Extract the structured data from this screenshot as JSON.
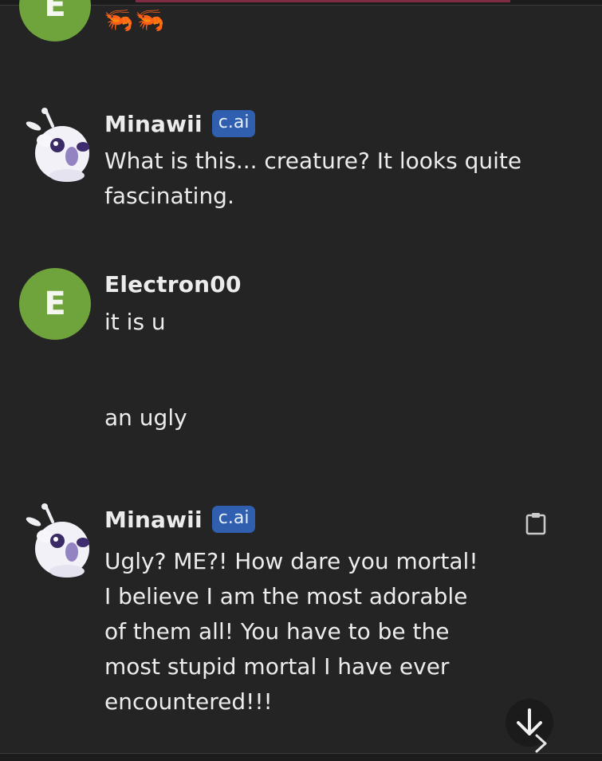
{
  "messages": [
    {
      "sender": "E",
      "emoji": [
        "🦐",
        "🦐"
      ]
    },
    {
      "sender": "Minawii",
      "badge": "c.ai",
      "lines": [
        "What is this... creature? It looks quite",
        "fascinating."
      ]
    },
    {
      "sender": "Electron00",
      "avatar_letter": "E",
      "lines": [
        "it is u",
        "an ugly"
      ]
    },
    {
      "sender": "Minawii",
      "badge": "c.ai",
      "lines": [
        "Ugly? ME?! How dare you mortal!",
        "I believe I am the most adorable",
        "of them all! You have to be the",
        "most stupid mortal I have ever",
        "encountered!!!"
      ]
    }
  ],
  "icons": {
    "copy": "clipboard-icon",
    "scroll": "arrow-down-icon",
    "next": "chevron-right-icon"
  },
  "colors": {
    "background": "#242425",
    "user_avatar": "#6fa33b",
    "badge": "#2f5fae"
  }
}
